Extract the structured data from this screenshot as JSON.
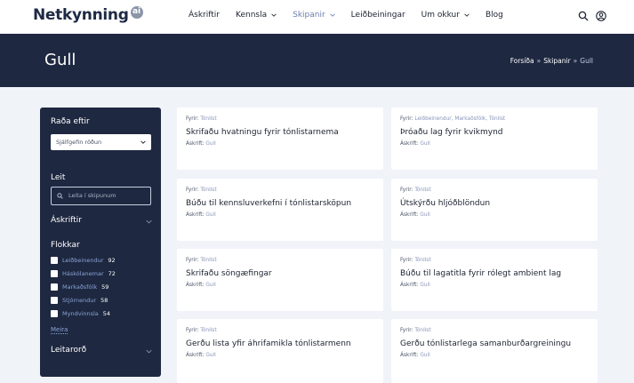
{
  "header": {
    "logo_text": "Netkynning",
    "logo_badge": "ai",
    "nav": [
      {
        "label": "Áskriftir",
        "has_dropdown": false,
        "active": false
      },
      {
        "label": "Kennsla",
        "has_dropdown": true,
        "active": false
      },
      {
        "label": "Skipanir",
        "has_dropdown": true,
        "active": true
      },
      {
        "label": "Leiðbeiningar",
        "has_dropdown": false,
        "active": false
      },
      {
        "label": "Um okkur",
        "has_dropdown": true,
        "active": false
      },
      {
        "label": "Blog",
        "has_dropdown": false,
        "active": false
      }
    ],
    "icons": [
      "search-icon",
      "user-icon"
    ]
  },
  "hero": {
    "title": "Gull",
    "breadcrumb": [
      "Forsíða",
      "Skipanir",
      "Gull"
    ],
    "breadcrumb_sep": "»"
  },
  "sidebar": {
    "sort_heading": "Raða eftir",
    "sort_value": "Sjálfgefin röðun",
    "search_heading": "Leit",
    "search_placeholder": "Leita í skipunum",
    "subscriptions_heading": "Áskriftir",
    "categories_heading": "Flokkar",
    "categories": [
      {
        "label": "Leiðbeinendur",
        "count": "92"
      },
      {
        "label": "Háskólanemar",
        "count": "72"
      },
      {
        "label": "Markaðsfólk",
        "count": "59"
      },
      {
        "label": "Stjórnendur",
        "count": "58"
      },
      {
        "label": "Myndvinnsla",
        "count": "54"
      }
    ],
    "more_link": "Meira",
    "keywords_heading": "Leitarorð"
  },
  "cards": [
    {
      "fyrir_label": "Fyrir:",
      "fyrir": "Tónlist",
      "title": "Skrifaðu hvatningu fyrir tónlistarnema",
      "askrift_label": "Áskrift:",
      "askrift": "Gull"
    },
    {
      "fyrir_label": "Fyrir:",
      "fyrir": "Leiðbeinendur, Markaðsfólk, Tónlist",
      "title": "Þróaðu lag fyrir kvikmynd",
      "askrift_label": "Áskrift:",
      "askrift": "Gull"
    },
    {
      "fyrir_label": "Fyrir:",
      "fyrir": "Tónlist",
      "title": "Búðu til kennsluverkefni í tónlistarsköpun",
      "askrift_label": "Áskrift:",
      "askrift": "Gull"
    },
    {
      "fyrir_label": "Fyrir:",
      "fyrir": "Tónlist",
      "title": "Útskýrðu hljóðblöndun",
      "askrift_label": "Áskrift:",
      "askrift": "Gull"
    },
    {
      "fyrir_label": "Fyrir:",
      "fyrir": "Tónlist",
      "title": "Skrifaðu söngæfingar",
      "askrift_label": "Áskrift:",
      "askrift": "Gull"
    },
    {
      "fyrir_label": "Fyrir:",
      "fyrir": "Tónlist",
      "title": "Búðu til lagatitla fyrir rólegt ambient lag",
      "askrift_label": "Áskrift:",
      "askrift": "Gull"
    },
    {
      "fyrir_label": "Fyrir:",
      "fyrir": "Tónlist",
      "title": "Gerðu lista yfir áhrifamikla tónlistarmenn",
      "askrift_label": "Áskrift:",
      "askrift": "Gull"
    },
    {
      "fyrir_label": "Fyrir:",
      "fyrir": "Tónlist",
      "title": "Gerðu tónlistarlega samanburðargreiningu",
      "askrift_label": "Áskrift:",
      "askrift": "Gull"
    }
  ],
  "colors": {
    "dark_navy": "#1e2840",
    "accent_link": "#8aa3d6",
    "active_nav": "#6b7eaf",
    "page_bg": "#f0f3f8"
  }
}
